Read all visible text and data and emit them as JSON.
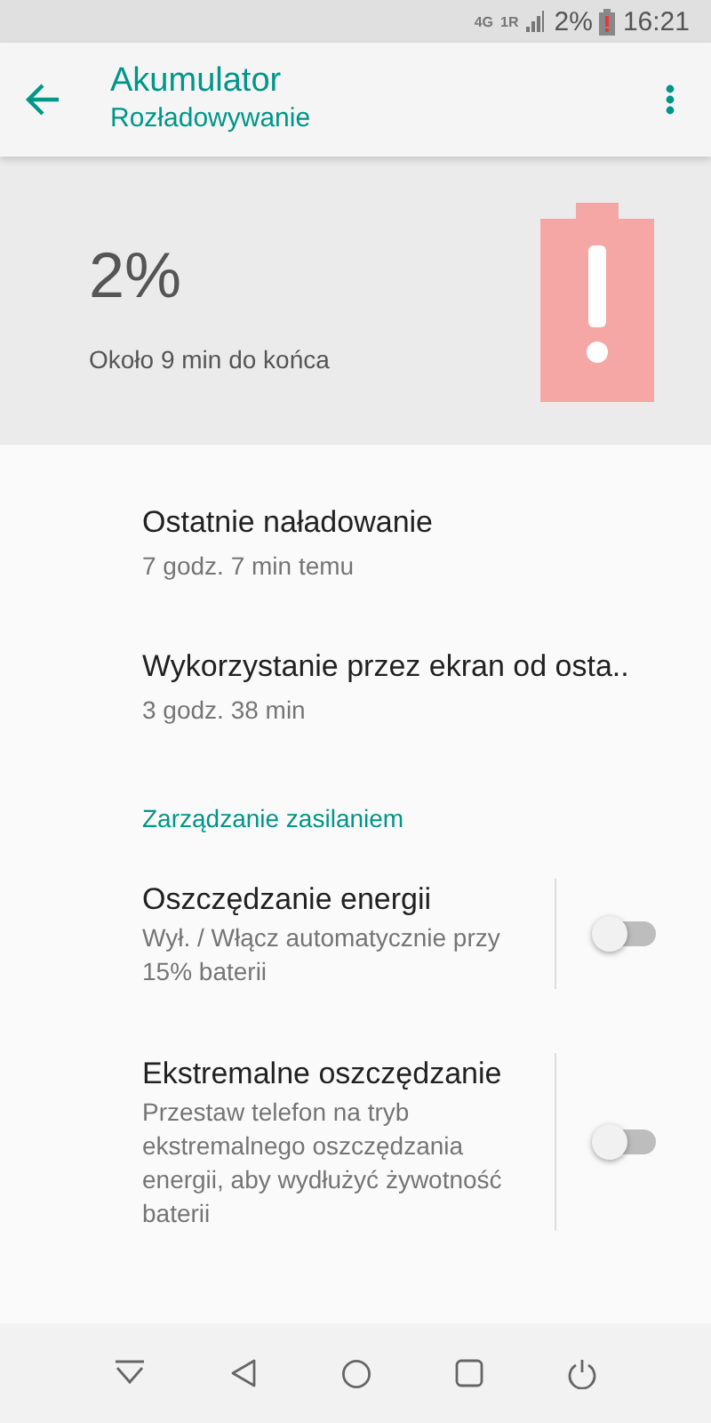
{
  "status_bar": {
    "network_4g": "4G",
    "sim": "1R",
    "battery_percent": "2%",
    "time": "16:21"
  },
  "app_bar": {
    "title": "Akumulator",
    "subtitle": "Rozładowywanie"
  },
  "battery_header": {
    "percent": "2%",
    "remaining": "Około 9 min do końca"
  },
  "items": [
    {
      "kind": "info",
      "title": "Ostatnie naładowanie",
      "summary": "7 godz. 7 min temu"
    },
    {
      "kind": "info",
      "title": "Wykorzystanie przez ekran od osta..",
      "summary": "3 godz. 38 min"
    },
    {
      "kind": "section",
      "title": "Zarządzanie zasilaniem"
    },
    {
      "kind": "switch",
      "title": "Oszczędzanie energii",
      "summary": "Wył. / Włącz automatycznie przy 15% baterii",
      "on": false
    },
    {
      "kind": "switch",
      "title": "Ekstremalne oszczędzanie",
      "summary": "Przestaw telefon na tryb ekstremalnego oszczędzania energii, aby wydłużyć żywotność baterii",
      "on": false
    }
  ]
}
